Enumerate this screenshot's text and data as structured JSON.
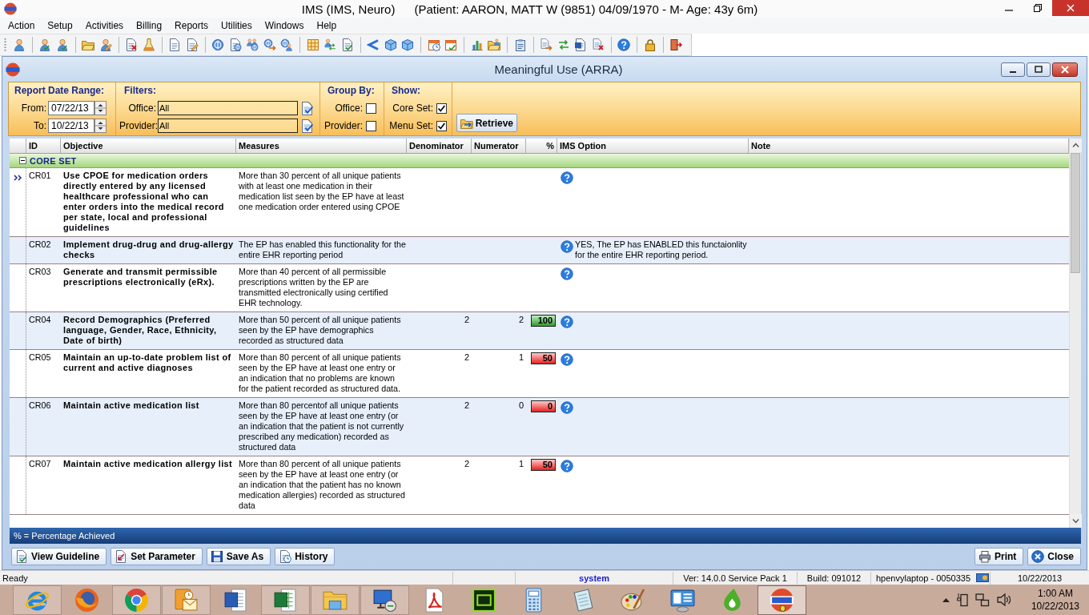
{
  "app": {
    "title": "IMS (IMS, Neuro)",
    "patient": "(Patient: AARON, MATT W (9851) 04/09/1970 - M- Age: 43y 6m)"
  },
  "menu": [
    "Action",
    "Setup",
    "Activities",
    "Billing",
    "Reports",
    "Utilities",
    "Windows",
    "Help"
  ],
  "toolbar": [
    [
      {
        "kind": "person"
      }
    ],
    [
      {
        "kind": "personcheck"
      },
      {
        "kind": "personcheck"
      }
    ],
    [
      {
        "kind": "folder"
      },
      {
        "kind": "personedit"
      }
    ],
    [
      {
        "kind": "rxdoc"
      },
      {
        "kind": "flask"
      }
    ],
    [
      {
        "kind": "doc"
      },
      {
        "kind": "notes"
      }
    ],
    [
      {
        "kind": "coin"
      },
      {
        "kind": "coindoc"
      },
      {
        "kind": "peoplecoin"
      },
      {
        "kind": "coinarrow"
      },
      {
        "kind": "coinperson"
      }
    ],
    [
      {
        "kind": "grid"
      },
      {
        "kind": "personarrows"
      },
      {
        "kind": "doccheck"
      }
    ],
    [
      {
        "kind": "chevron"
      },
      {
        "kind": "cube"
      },
      {
        "kind": "cube"
      }
    ],
    [
      {
        "kind": "calendarclock"
      },
      {
        "kind": "calendarcheck"
      }
    ],
    [
      {
        "kind": "chart"
      },
      {
        "kind": "personfolder"
      }
    ],
    [
      {
        "kind": "clipboard"
      }
    ],
    [
      {
        "kind": "docarrow"
      },
      {
        "kind": "exchange"
      },
      {
        "kind": "banddoc"
      },
      {
        "kind": "docx"
      }
    ],
    [
      {
        "kind": "help"
      }
    ],
    [
      {
        "kind": "lock"
      }
    ],
    [
      {
        "kind": "exit"
      }
    ]
  ],
  "window": {
    "title": "Meaningful Use (ARRA)"
  },
  "filters": {
    "date_range": {
      "heading": "Report Date Range:",
      "fields": [
        {
          "label": "From:",
          "value": "07/22/13"
        },
        {
          "label": "To:",
          "value": "10/22/13"
        }
      ]
    },
    "filter": {
      "heading": "Filters:",
      "fields": [
        {
          "label": "Office:",
          "value": "All"
        },
        {
          "label": "Provider:",
          "value": "All"
        }
      ]
    },
    "group_by": {
      "heading": "Group By:",
      "options": [
        {
          "label": "Office:",
          "checked": false
        },
        {
          "label": "Provider:",
          "checked": false
        }
      ]
    },
    "show": {
      "heading": "Show:",
      "options": [
        {
          "label": "Core Set:",
          "checked": true
        },
        {
          "label": "Menu Set:",
          "checked": true
        }
      ]
    },
    "retrieve": "Retrieve"
  },
  "table": {
    "columns": [
      "ID",
      "Objective",
      "Measures",
      "Denominator",
      "Numerator",
      "%",
      "IMS Option",
      "Note"
    ],
    "groups": [
      {
        "label": "CORE SET",
        "expanded": true,
        "rows": [
          {
            "id": "CR01",
            "selected": true,
            "objective": "Use CPOE for medication orders directly entered by any licensed healthcare professional who can enter orders into the medical record per state, local and professional guidelines",
            "measures": "More than 30 percent of all unique patients with at least one medication in their medication list seen by the EP have at least one medication order entered using CPOE"
          },
          {
            "id": "CR02",
            "selected": false,
            "objective": "Implement drug-drug and drug-allergy checks",
            "measures": "The EP has enabled this functionality for the entire EHR reporting period",
            "option": "YES, The EP has ENABLED this functaionlity for the entire EHR reporting period."
          },
          {
            "id": "CR03",
            "selected": false,
            "objective": "Generate and transmit permissible prescriptions electronically (eRx).",
            "measures": "More than 40 percent of all permissible prescriptions written by the EP are transmitted electronically using certified EHR technology."
          },
          {
            "id": "CR04",
            "selected": false,
            "objective": "Record Demographics (Preferred language, Gender, Race, Ethnicity, Date of birth)",
            "measures": "More than 50 percent of all unique patients seen by the EP have demographics recorded as structured data",
            "denominator": "2",
            "numerator": "2",
            "percent": "100",
            "met": true
          },
          {
            "id": "CR05",
            "selected": false,
            "objective": "Maintain an up-to-date problem list of current and active diagnoses",
            "measures": "More than 80 percent of all unique patients seen by the EP have at least one entry or an indication that no problems are known for the patient recorded as structured data.",
            "denominator": "2",
            "numerator": "1",
            "percent": "50",
            "met": false
          },
          {
            "id": "CR06",
            "selected": false,
            "objective": "Maintain active medication list",
            "measures": "More than 80 percentof all unique patients seen by the EP have at least one entry (or an indication that the patient is not currently prescribed any medication) recorded as structured data",
            "denominator": "2",
            "numerator": "0",
            "percent": "0",
            "met": false
          },
          {
            "id": "CR07",
            "selected": false,
            "objective": "Maintain active medication allergy list",
            "measures": "More than 80 percent of all unique patients seen by the EP have at least one entry (or an indication that the patient has no known medication allergies) recorded as structured data",
            "denominator": "2",
            "numerator": "1",
            "percent": "50",
            "met": false
          }
        ]
      }
    ]
  },
  "legend": "% = Percentage Achieved",
  "buttons": {
    "left": [
      {
        "kind": "guideline",
        "label": "View Guideline"
      },
      {
        "kind": "parameter",
        "label": "Set Parameter"
      },
      {
        "kind": "save",
        "label": "Save As"
      },
      {
        "kind": "history",
        "label": "History"
      }
    ],
    "right": [
      {
        "kind": "print",
        "label": "Print"
      },
      {
        "kind": "close",
        "label": "Close"
      }
    ]
  },
  "status_bar": {
    "message": "Ready",
    "user": "system",
    "version": "Ver: 14.0.0 Service Pack 1",
    "build": "Build: 091012",
    "machine": "hpenvylaptop - 0050335",
    "date": "10/22/2013"
  },
  "taskbar": {
    "apps": [
      {
        "kind": "ebrowser",
        "running": true,
        "selected": false
      },
      {
        "kind": "foxbrowser",
        "running": false,
        "selected": false
      },
      {
        "kind": "wheel",
        "running": true,
        "selected": false
      },
      {
        "kind": "mail",
        "running": true,
        "selected": false
      },
      {
        "kind": "wordproc",
        "running": false,
        "selected": false
      },
      {
        "kind": "spreadsheet",
        "running": true,
        "selected": false
      },
      {
        "kind": "folder",
        "running": true,
        "selected": false
      },
      {
        "kind": "remote",
        "running": true,
        "selected": false
      },
      {
        "kind": "pdf",
        "running": false,
        "selected": false
      },
      {
        "kind": "dw",
        "running": false,
        "selected": false
      },
      {
        "kind": "calculator",
        "running": false,
        "selected": false
      },
      {
        "kind": "notepad",
        "running": false,
        "selected": false
      },
      {
        "kind": "paint",
        "running": false,
        "selected": false
      },
      {
        "kind": "panel",
        "running": false,
        "selected": false
      },
      {
        "kind": "flame",
        "running": false,
        "selected": false
      },
      {
        "kind": "ims",
        "running": true,
        "selected": true
      }
    ],
    "clock": {
      "time": "1:00 AM",
      "date": "10/22/2013"
    }
  }
}
